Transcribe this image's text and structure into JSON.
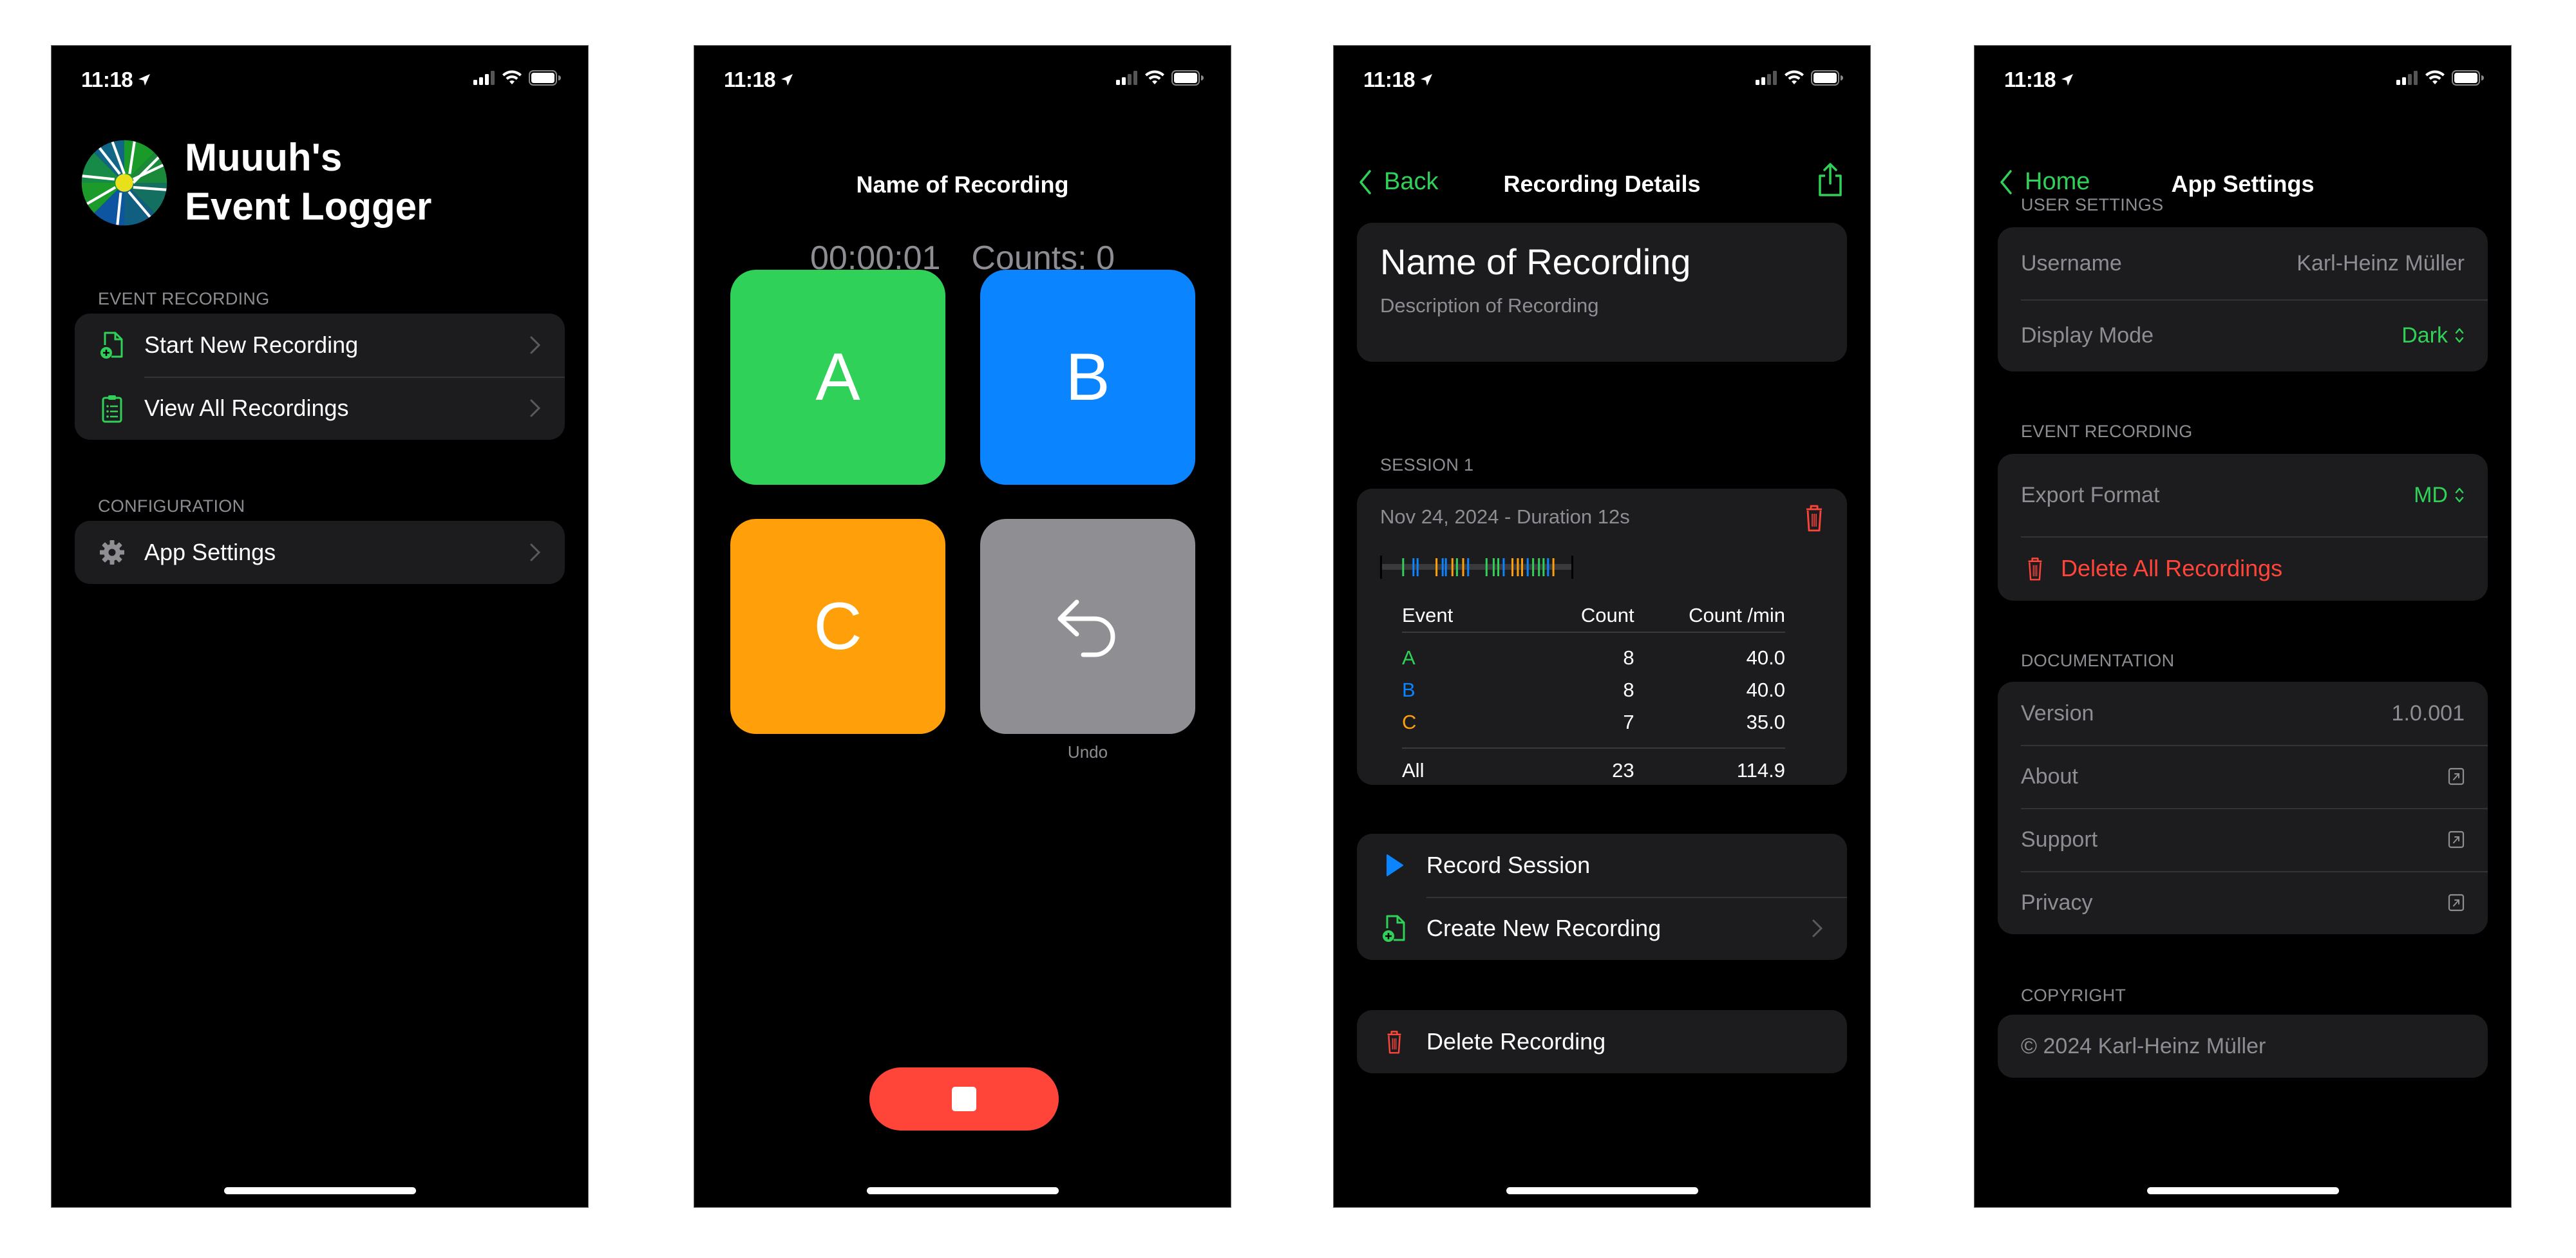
{
  "status_bar": {
    "time": "11:18"
  },
  "colors": {
    "accent_green": "#30d158",
    "accent_blue": "#0a84ff",
    "accent_orange": "#ff9f0a",
    "undo_gray": "#8e8e93",
    "destructive_red": "#ff453a",
    "background": "#000000",
    "card": "#1c1c1e",
    "secondary_text": "#8d8d93"
  },
  "home": {
    "app_title_line1": "Muuuh's",
    "app_title_line2": "Event Logger",
    "sections": [
      {
        "header": "EVENT RECORDING",
        "items": [
          {
            "label": "Start New Recording",
            "icon": "doc-badge-plus-icon"
          },
          {
            "label": "View All Recordings",
            "icon": "clipboard-list-icon"
          }
        ]
      },
      {
        "header": "CONFIGURATION",
        "items": [
          {
            "label": "App Settings",
            "icon": "gear-icon"
          }
        ]
      }
    ]
  },
  "recording": {
    "title": "Name of Recording",
    "timer": "00:00:01",
    "counts": "Counts: 0",
    "buttons": [
      {
        "label": "A",
        "color": "#30d158"
      },
      {
        "label": "B",
        "color": "#0a84ff"
      },
      {
        "label": "C",
        "color": "#ff9f0a"
      }
    ],
    "undo_label": "Undo"
  },
  "detail": {
    "back_label": "Back",
    "title": "Recording Details",
    "name": "Name of Recording",
    "description": "Description of Recording",
    "session_header": "SESSION 1",
    "session_date": "Nov 24, 2024 - Duration 12s",
    "timeline": {
      "duration_s": 12,
      "events": [
        {
          "event": "A",
          "t": 1.37
        },
        {
          "event": "B",
          "t": 2.02
        },
        {
          "event": "B",
          "t": 2.28
        },
        {
          "event": "C",
          "t": 3.47
        },
        {
          "event": "B",
          "t": 3.86
        },
        {
          "event": "B",
          "t": 4.06
        },
        {
          "event": "C",
          "t": 4.47
        },
        {
          "event": "A",
          "t": 4.76
        },
        {
          "event": "C",
          "t": 5.15
        },
        {
          "event": "B",
          "t": 5.46
        },
        {
          "event": "A",
          "t": 6.62
        },
        {
          "event": "A",
          "t": 7.07
        },
        {
          "event": "A",
          "t": 7.36
        },
        {
          "event": "B",
          "t": 7.7
        },
        {
          "event": "C",
          "t": 8.25
        },
        {
          "event": "C",
          "t": 8.59
        },
        {
          "event": "C",
          "t": 8.86
        },
        {
          "event": "B",
          "t": 9.21
        },
        {
          "event": "A",
          "t": 9.55
        },
        {
          "event": "A",
          "t": 9.92
        },
        {
          "event": "A",
          "t": 10.21
        },
        {
          "event": "B",
          "t": 10.49
        },
        {
          "event": "C",
          "t": 10.83
        }
      ]
    },
    "table": {
      "headers": [
        "Event",
        "Count",
        "Count /min"
      ],
      "rows": [
        {
          "event": "A",
          "count": "8",
          "per_min": "40.0"
        },
        {
          "event": "B",
          "count": "8",
          "per_min": "40.0"
        },
        {
          "event": "C",
          "count": "7",
          "per_min": "35.0"
        }
      ],
      "total": {
        "event": "All",
        "count": "23",
        "per_min": "114.9"
      }
    },
    "actions": [
      {
        "label": "Record Session",
        "icon": "play-icon"
      },
      {
        "label": "Create New Recording",
        "icon": "doc-badge-plus-icon"
      }
    ],
    "delete_label": "Delete Recording"
  },
  "settings": {
    "back_label": "Home",
    "title": "App Settings",
    "user_settings": {
      "header": "USER SETTINGS",
      "username_label": "Username",
      "username_value": "Karl-Heinz Müller",
      "display_mode_label": "Display Mode",
      "display_mode_value": "Dark"
    },
    "event_recording": {
      "header": "EVENT RECORDING",
      "export_format_label": "Export Format",
      "export_format_value": "MD",
      "delete_all_label": "Delete All Recordings"
    },
    "documentation": {
      "header": "DOCUMENTATION",
      "version_label": "Version",
      "version_value": "1.0.001",
      "links": [
        "About",
        "Support",
        "Privacy"
      ]
    },
    "copyright": {
      "header": "COPYRIGHT",
      "text": "© 2024 Karl-Heinz Müller"
    }
  }
}
